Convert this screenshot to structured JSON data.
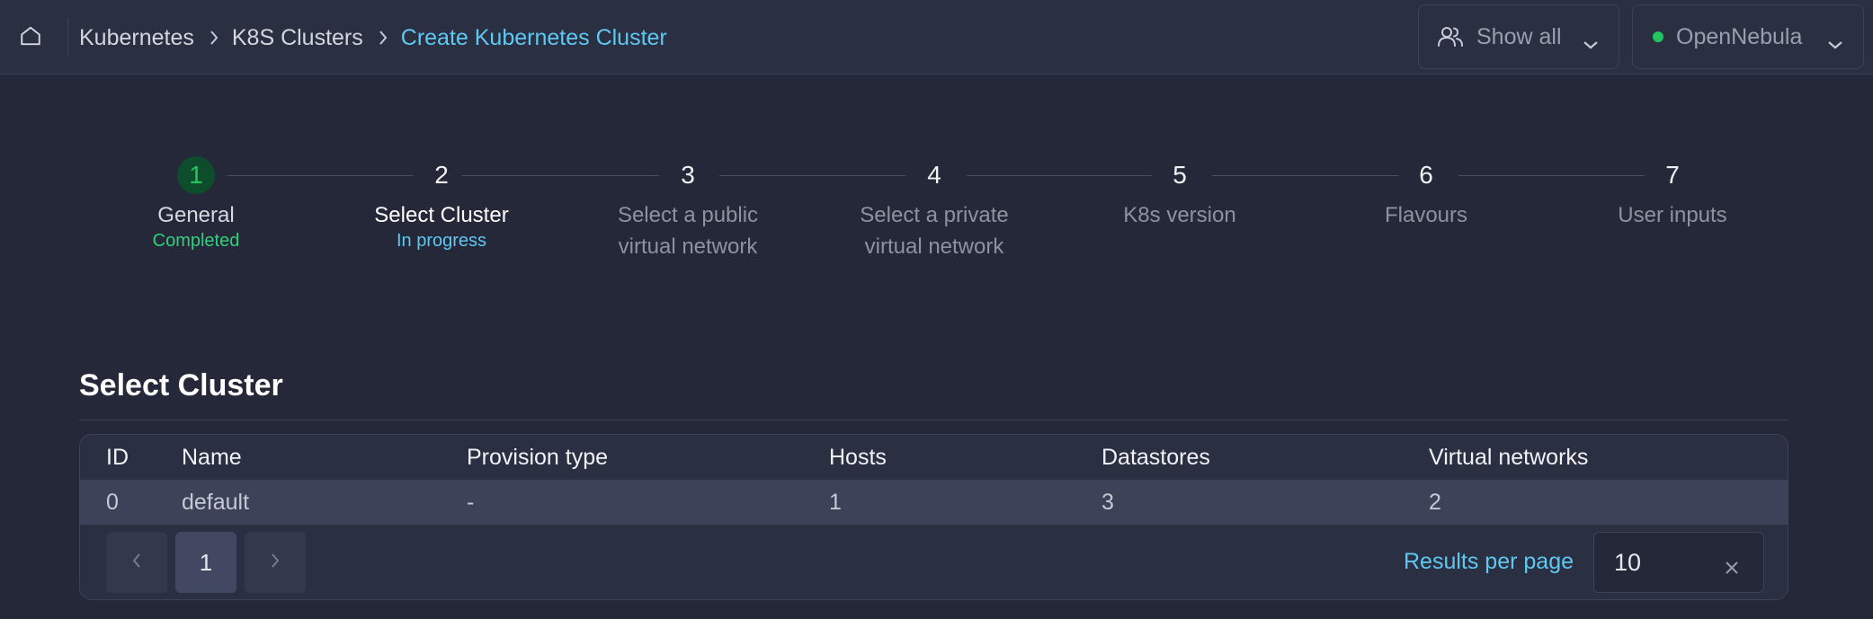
{
  "breadcrumb": {
    "items": [
      "Kubernetes",
      "K8S Clusters"
    ],
    "current": "Create Kubernetes Cluster"
  },
  "group_selector": {
    "label": "Show all",
    "icon": "users-icon"
  },
  "zone_selector": {
    "label": "OpenNebula",
    "status_color": "#22c55e"
  },
  "stepper": {
    "steps": [
      {
        "num": "1",
        "label_lines": [
          "General"
        ],
        "status": "Completed"
      },
      {
        "num": "2",
        "label_lines": [
          "Select Cluster"
        ],
        "status": "In progress"
      },
      {
        "num": "3",
        "label_lines": [
          "Select a public",
          "virtual network"
        ]
      },
      {
        "num": "4",
        "label_lines": [
          "Select a private",
          "virtual network"
        ]
      },
      {
        "num": "5",
        "label_lines": [
          "K8s version"
        ]
      },
      {
        "num": "6",
        "label_lines": [
          "Flavours"
        ]
      },
      {
        "num": "7",
        "label_lines": [
          "User inputs"
        ]
      }
    ]
  },
  "section": {
    "title": "Select Cluster"
  },
  "table": {
    "columns": [
      "ID",
      "Name",
      "Provision type",
      "Hosts",
      "Datastores",
      "Virtual networks"
    ],
    "rows": [
      {
        "id": "0",
        "name": "default",
        "provision_type": "-",
        "hosts": "1",
        "datastores": "3",
        "virtual_networks": "2"
      }
    ]
  },
  "pagination": {
    "current_page": "1",
    "results_per_page_label": "Results per page",
    "results_per_page_value": "10"
  },
  "colors": {
    "accent": "#5ec8f2",
    "success": "#22c55e",
    "background": "#252838",
    "surface": "#2b2f42"
  }
}
